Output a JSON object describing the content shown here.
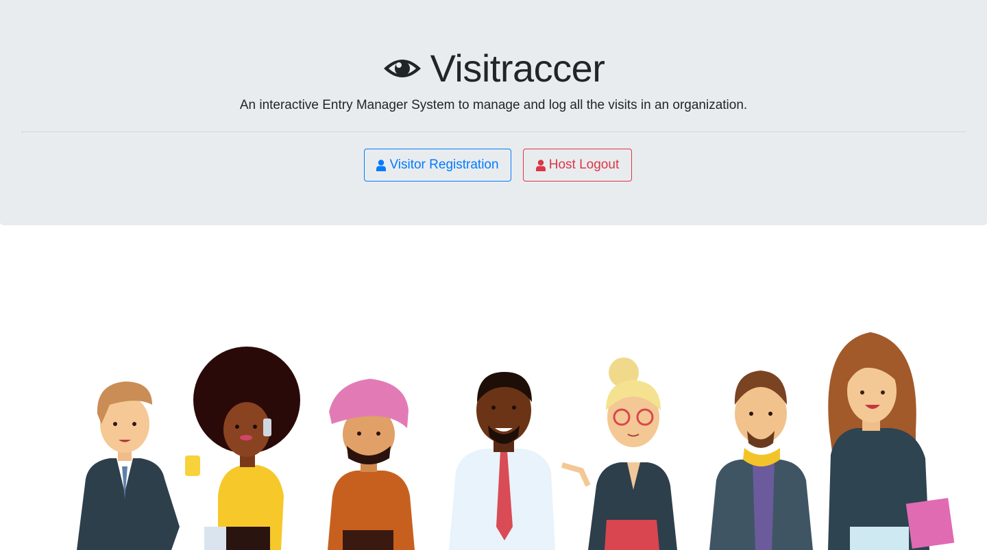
{
  "header": {
    "title": "Visitraccer",
    "logo_icon": "eye-icon",
    "lead": "An interactive Entry Manager System to manage and log all the visits in an organization."
  },
  "actions": {
    "visitor_registration": {
      "label": "Visitor Registration",
      "icon": "user-icon",
      "color": "#007bff"
    },
    "host_logout": {
      "label": "Host Logout",
      "icon": "user-icon",
      "color": "#dc3545"
    }
  },
  "colors": {
    "jumbotron_bg": "#e9ecef",
    "text": "#212529"
  },
  "illustration": {
    "name": "people-illustration",
    "figure_count": 7
  }
}
